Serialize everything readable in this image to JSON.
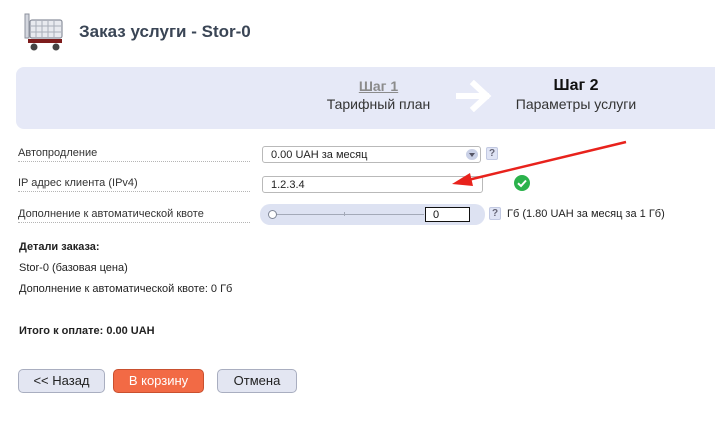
{
  "header": {
    "title": "Заказ услуги - Stor-0",
    "icon": "shopping-cart-icon"
  },
  "steps": {
    "step1": {
      "title": "Шаг 1",
      "subtitle": "Тарифный план"
    },
    "step2": {
      "title": "Шаг 2",
      "subtitle": "Параметры услуги"
    },
    "arrow_icon": "arrow-right-icon"
  },
  "form": {
    "autorenew": {
      "label": "Автопродление",
      "value": "0.00 UAH за месяц",
      "help": "?"
    },
    "ip": {
      "label": "IP адрес клиента (IPv4)",
      "value": "1.2.3.4",
      "status_icon": "check-circle-icon",
      "status_color": "#2bb24c"
    },
    "quota": {
      "label": "Дополнение к автоматической квоте",
      "value": "0",
      "slider_fraction": 0,
      "help": "?",
      "unit_text": "Гб (1.80 UAH за месяц за 1 Гб)"
    }
  },
  "details": {
    "title": "Детали заказа:",
    "lines": [
      "Stor-0 (базовая цена)",
      "Дополнение к автоматической квоте: 0 Гб"
    ],
    "total": "Итого к оплате: 0.00 UAH"
  },
  "buttons": {
    "back": "<< Назад",
    "cart": "В корзину",
    "cancel": "Отмена"
  },
  "colors": {
    "steps_bg": "#e6e9f7",
    "cart_button": "#f26a45",
    "annotation_arrow": "#e8221c"
  }
}
